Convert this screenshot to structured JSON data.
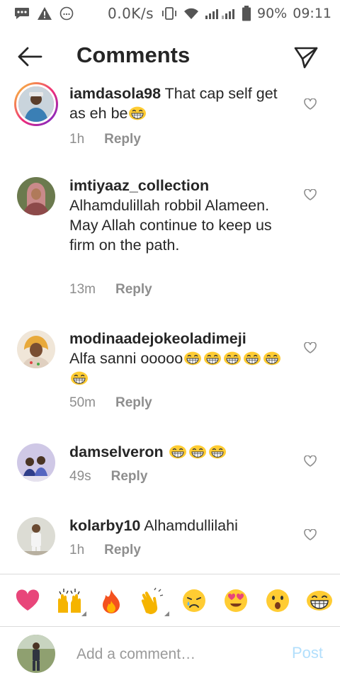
{
  "status_bar": {
    "net_speed": "0.0K/s",
    "battery": "90%",
    "time": "09:11"
  },
  "header": {
    "title": "Comments"
  },
  "comments": [
    {
      "username": "iamdasola98",
      "text": "That cap self get as eh be",
      "emojis": [
        "grin-emoji"
      ],
      "time": "1h",
      "reply_label": "Reply"
    },
    {
      "username": "imtiyaaz_collection",
      "text": "Alhamdulillah robbil Alameen. May Allah continue to keep us firm on the path.",
      "emojis": [],
      "time": "13m",
      "reply_label": "Reply"
    },
    {
      "username": "modinaadejokeoladimeji",
      "text": "Alfa sanni ooooo",
      "emojis": [
        "grin-emoji",
        "grin-emoji",
        "grin-emoji",
        "grin-emoji",
        "grin-emoji",
        "grin-emoji"
      ],
      "time": "50m",
      "reply_label": "Reply"
    },
    {
      "username": "damselveron",
      "text": "",
      "emojis": [
        "grin-emoji",
        "grin-emoji",
        "grin-emoji"
      ],
      "time": "49s",
      "reply_label": "Reply"
    },
    {
      "username": "kolarby10",
      "text": "Alhamdullilahi",
      "emojis": [],
      "time": "1h",
      "reply_label": "Reply"
    }
  ],
  "emoji_bar": [
    "heart-emoji",
    "raising-hands-emoji",
    "fire-emoji",
    "clapping-hands-emoji",
    "crying-face-emoji",
    "heart-eyes-emoji",
    "open-mouth-emoji",
    "grin-emoji"
  ],
  "comment_input": {
    "placeholder": "Add a comment…",
    "post_label": "Post"
  },
  "colors": {
    "text": "#262626",
    "secondary": "#8e8e8e",
    "post_disabled": "#b2dffc",
    "divider": "#dbdbdb"
  }
}
